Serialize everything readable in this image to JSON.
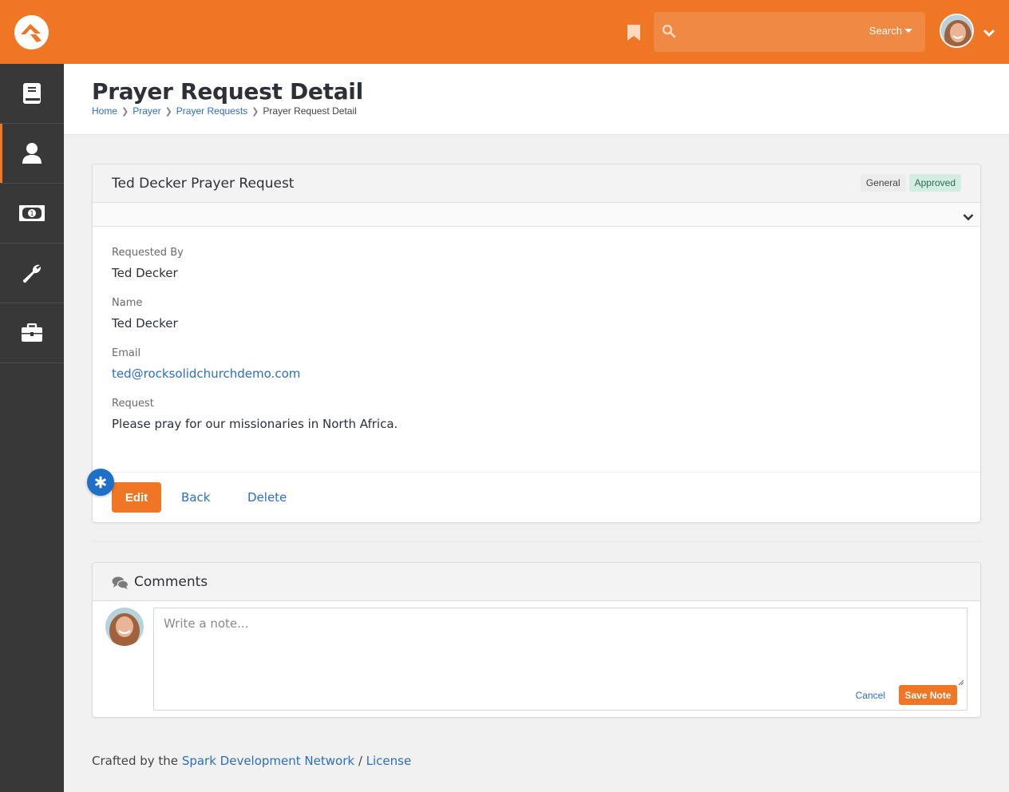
{
  "app": {
    "brand_color": "#ee7625",
    "link_color": "#2c6fc2",
    "sidebar_color": "#383838"
  },
  "topbar": {
    "logo": "rock-logo-icon",
    "bookmark": "bookmark-icon",
    "search": {
      "placeholder": "",
      "button_label": "Search",
      "icon": "search-icon"
    },
    "user_menu": {
      "avatar": "user-avatar",
      "icon": "chevron-down-icon"
    }
  },
  "sidebar": {
    "items": [
      {
        "name": "book",
        "icon": "book-icon",
        "active": false
      },
      {
        "name": "people",
        "icon": "user-icon",
        "active": true
      },
      {
        "name": "finance",
        "icon": "money-icon",
        "active": false
      },
      {
        "name": "tools",
        "icon": "wrench-icon",
        "active": false
      },
      {
        "name": "admin",
        "icon": "briefcase-icon",
        "active": false
      }
    ]
  },
  "page": {
    "title": "Prayer Request Detail",
    "breadcrumb": [
      {
        "label": "Home",
        "link": true
      },
      {
        "label": "Prayer",
        "link": true
      },
      {
        "label": "Prayer Requests",
        "link": true
      },
      {
        "label": "Prayer Request Detail",
        "link": false
      }
    ]
  },
  "request_panel": {
    "title": "Ted Decker Prayer Request",
    "labels": [
      {
        "text": "General",
        "style": "default"
      },
      {
        "text": "Approved",
        "style": "success"
      }
    ],
    "fields": [
      {
        "label": "Requested By",
        "value": "Ted Decker"
      },
      {
        "label": "Name",
        "value": "Ted Decker"
      },
      {
        "label": "Email",
        "value": "ted@rocksolidchurchdemo.com"
      },
      {
        "label": "Request",
        "value": "Please pray for our missionaries in North Africa."
      }
    ],
    "actions": {
      "edit": "Edit",
      "back": "Back",
      "delete": "Delete"
    }
  },
  "comments_panel": {
    "title": "Comments",
    "note": {
      "placeholder": "Write a note...",
      "value": ""
    },
    "cancel": "Cancel",
    "save": "Save Note"
  },
  "footer": {
    "prefix": "Crafted by the ",
    "link1": "Spark Development Network",
    "separator": " / ",
    "link2": "License"
  }
}
